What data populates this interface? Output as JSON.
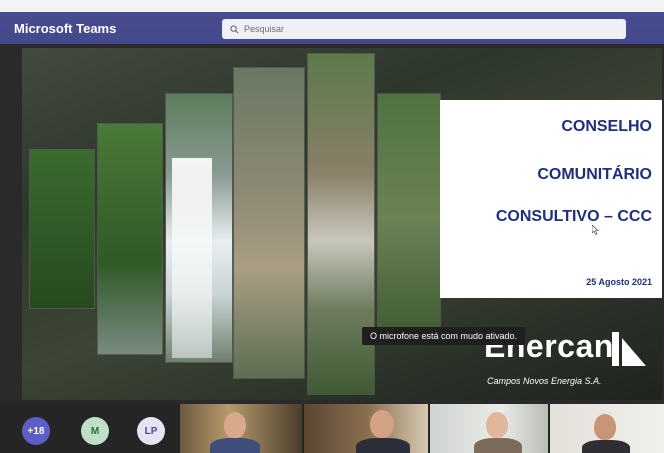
{
  "window": {
    "app_title": "Microsoft Teams"
  },
  "search": {
    "placeholder": "Pesquisar"
  },
  "slide": {
    "title_lines": [
      "CONSELHO",
      "COMUNITÁRIO",
      "CONSULTIVO – CCC"
    ],
    "date": "25 Agosto 2021",
    "brand_name": "Enercan",
    "brand_subtitle": "Campos Novos Energia S.A.",
    "title_color": "#1f2f7a"
  },
  "notification": {
    "text": "O microfone está com mudo ativado."
  },
  "participants": {
    "overflow_count": "+18",
    "avatars": [
      {
        "initials": "M",
        "color": "#bfe0c8",
        "text_color": "#2f6b3f"
      },
      {
        "initials": "LP",
        "color": "#e6e3f3",
        "text_color": "#4b4f9a"
      }
    ],
    "video_tiles": 4
  },
  "colors": {
    "teams_header": "#464a8c",
    "roster_bg": "#252526",
    "overflow_badge": "#5b5fc7"
  }
}
